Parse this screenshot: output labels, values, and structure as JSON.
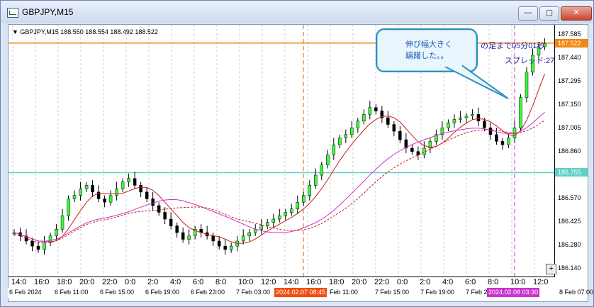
{
  "window": {
    "title": "GBPJPY,M15",
    "buttons": [
      "minimize",
      "maximize",
      "close"
    ],
    "button_glyphs": [
      "—",
      "▢",
      "✕"
    ]
  },
  "symbol_line": "▼ GBPJPY,M15  188.550 188.554 188.492 188.522",
  "callout": {
    "text": "伸び幅大きく\n躊躇した。。"
  },
  "info_text": {
    "line1": "の足まで05分01秒",
    "line2": "スプレッド:27"
  },
  "price_scale": [
    "187.585",
    "187.440",
    "187.295",
    "187.150",
    "187.005",
    "186.860",
    "186.715",
    "186.570",
    "186.425",
    "186.280",
    "186.140"
  ],
  "price_tags": [
    {
      "text": "187.522",
      "color": "#f0870f"
    },
    {
      "text": "186.755",
      "color": "#5fd0c5"
    }
  ],
  "time_scale": [
    "14:0",
    "16:0",
    "18:0",
    "20:0",
    "22:0",
    "0:0",
    "2:0",
    "4:0",
    "6:0",
    "8:0",
    "10:0",
    "12:0",
    "14:0",
    "16:0",
    "18:0",
    "20:0",
    "22:0",
    "0:0",
    "2:0",
    "4:0",
    "6:0",
    "8:0",
    "10:0",
    "12:0"
  ],
  "bottom_axis": [
    "6 Feb 2024",
    "6 Feb 11:00",
    "6 Feb 15:00",
    "6 Feb 19:00",
    "6 Feb 23:00",
    "7 Feb 03:00",
    "Feb 11:00",
    "7 Feb 15:00",
    "7 Feb 19:00",
    "7 Feb 2",
    "8 Feb 07:00"
  ],
  "bottom_tags": [
    {
      "text": "2024.02.07 08:45",
      "color": "#f04d12"
    },
    {
      "text": "2024.02.08 03:30",
      "color": "#cc33cc"
    }
  ],
  "colors": {
    "bull_candle": "#3cff3c",
    "bear_candle": "#000000",
    "ma_fast": "#c81e1e",
    "ma_slow": "#cc33cc",
    "grid": "#cccccc"
  },
  "candle_series": [
    186.4,
    186.38,
    186.35,
    186.32,
    186.3,
    186.34,
    186.38,
    186.42,
    186.5,
    186.6,
    186.62,
    186.66,
    186.68,
    186.64,
    186.6,
    186.58,
    186.62,
    186.66,
    186.7,
    186.72,
    186.68,
    186.64,
    186.6,
    186.56,
    186.52,
    186.48,
    186.44,
    186.4,
    186.36,
    186.38,
    186.42,
    186.4,
    186.38,
    186.35,
    186.32,
    186.3,
    186.32,
    186.35,
    186.38,
    186.4,
    186.42,
    186.44,
    186.46,
    186.48,
    186.5,
    186.52,
    186.54,
    186.58,
    186.62,
    186.68,
    186.74,
    186.8,
    186.86,
    186.92,
    186.96,
    186.98,
    187.02,
    187.06,
    187.1,
    187.14,
    187.12,
    187.08,
    187.04,
    187.0,
    186.95,
    186.9,
    186.88,
    186.86,
    186.9,
    186.94,
    186.98,
    187.02,
    187.05,
    187.07,
    187.08,
    187.09,
    187.1,
    187.06,
    187.02,
    186.98,
    186.94,
    186.92,
    186.96,
    187.02,
    187.2,
    187.35,
    187.45,
    187.5,
    187.52
  ]
}
